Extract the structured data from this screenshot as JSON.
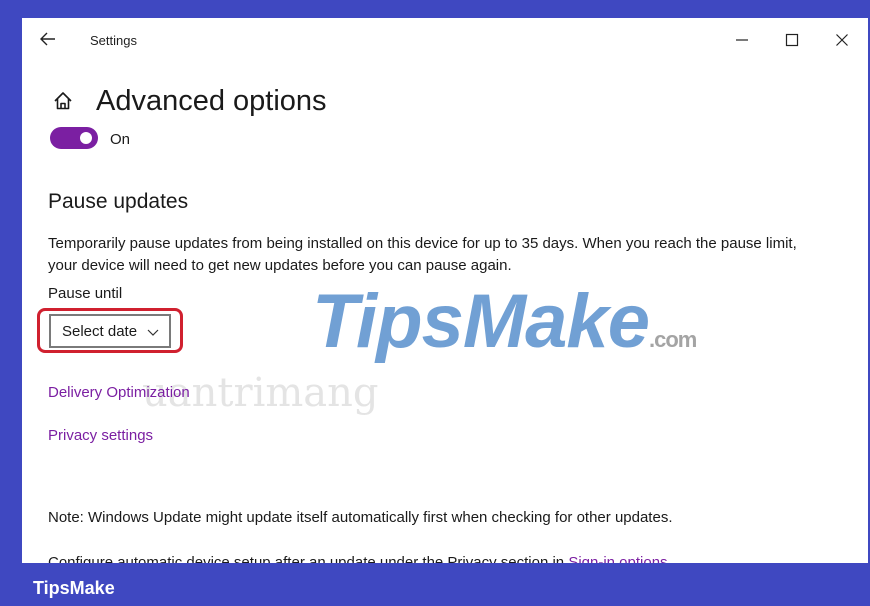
{
  "window": {
    "app_title": "Settings",
    "controls": [
      "minimize",
      "maximize",
      "close"
    ]
  },
  "page": {
    "title": "Advanced options",
    "toggle_state": "On",
    "toggle_on": true,
    "section_title": "Pause updates",
    "description_line1": "Temporarily pause updates from being installed on this device for up to 35 days. When you reach the pause limit,",
    "description_line2": "your device will need to get new updates before you can pause again.",
    "pause_until_label": "Pause until",
    "select_value": "Select date",
    "links": {
      "delivery_optimization": "Delivery Optimization",
      "privacy_settings": "Privacy settings"
    },
    "note": "Note: Windows Update might update itself automatically first when checking for other updates.",
    "truncated_line": "Configure automatic device setup after an update under the Privacy section in ",
    "truncated_link": "Sign-in options."
  },
  "watermark": {
    "brand": "TipsMake",
    "brand_suffix": ".com",
    "secondary": "uantrimang"
  },
  "footer": {
    "brand_label": "TipsMake"
  },
  "colors": {
    "frame_blue": "#3f48c1",
    "accent_purple": "#7b1fa2",
    "highlight_red": "#d0202f"
  }
}
